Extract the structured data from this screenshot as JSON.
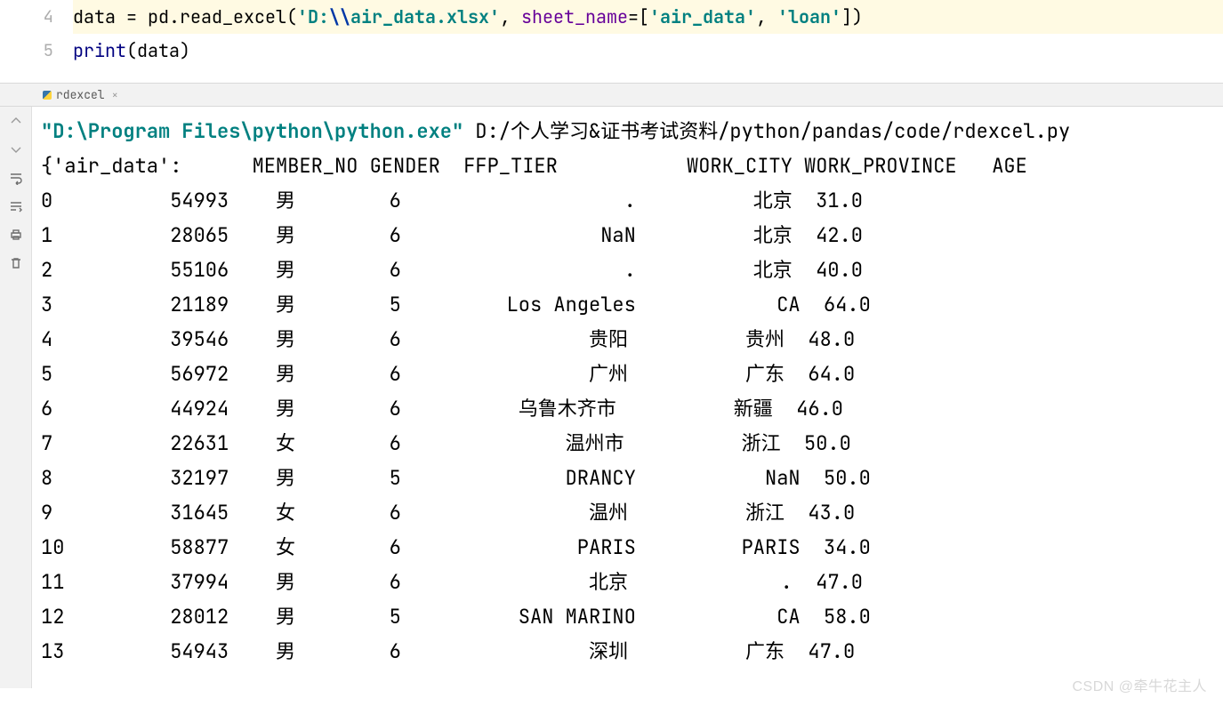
{
  "editor": {
    "lines": [
      {
        "num": "4",
        "tokens": [
          {
            "c": "tk-plain",
            "t": "data "
          },
          {
            "c": "tk-eq",
            "t": "= "
          },
          {
            "c": "tk-call",
            "t": "pd.read_excel("
          },
          {
            "c": "tk-str",
            "t": "'D:"
          },
          {
            "c": "tk-esc",
            "t": "\\\\"
          },
          {
            "c": "tk-str",
            "t": "air_data.xlsx'"
          },
          {
            "c": "tk-plain",
            "t": ", "
          },
          {
            "c": "tk-kw",
            "t": "sheet_name"
          },
          {
            "c": "tk-eq",
            "t": "=["
          },
          {
            "c": "tk-str",
            "t": "'air_data'"
          },
          {
            "c": "tk-plain",
            "t": ", "
          },
          {
            "c": "tk-str",
            "t": "'loan'"
          },
          {
            "c": "tk-plain",
            "t": "])"
          }
        ],
        "current": true
      },
      {
        "num": "5",
        "tokens": [
          {
            "c": "tk-builtin",
            "t": "print"
          },
          {
            "c": "tk-plain",
            "t": "(data)"
          }
        ],
        "current": false
      }
    ]
  },
  "panel": {
    "tab_label": "rdexcel",
    "tab_close": "×"
  },
  "console": {
    "run_line_tokens": [
      {
        "c": "run-str",
        "t": "\"D:\\Program Files\\python\\python.exe\""
      },
      {
        "c": "run-path",
        "t": " D:/个人学习&证书考试资料/python/pandas/code/rdexcel.py"
      }
    ],
    "header": "{'air_data':      MEMBER_NO GENDER  FFP_TIER           WORK_CITY WORK_PROVINCE   AGE",
    "rows": [
      {
        "idx": "0",
        "member": "54993",
        "gender": "男",
        "tier": "6",
        "city": ".",
        "prov": "北京",
        "age": "31.0"
      },
      {
        "idx": "1",
        "member": "28065",
        "gender": "男",
        "tier": "6",
        "city": "NaN",
        "prov": "北京",
        "age": "42.0"
      },
      {
        "idx": "2",
        "member": "55106",
        "gender": "男",
        "tier": "6",
        "city": ".",
        "prov": "北京",
        "age": "40.0"
      },
      {
        "idx": "3",
        "member": "21189",
        "gender": "男",
        "tier": "5",
        "city": "Los Angeles",
        "prov": "CA",
        "age": "64.0"
      },
      {
        "idx": "4",
        "member": "39546",
        "gender": "男",
        "tier": "6",
        "city": "贵阳",
        "prov": "贵州",
        "age": "48.0"
      },
      {
        "idx": "5",
        "member": "56972",
        "gender": "男",
        "tier": "6",
        "city": "广州",
        "prov": "广东",
        "age": "64.0"
      },
      {
        "idx": "6",
        "member": "44924",
        "gender": "男",
        "tier": "6",
        "city": "乌鲁木齐市",
        "prov": "新疆",
        "age": "46.0"
      },
      {
        "idx": "7",
        "member": "22631",
        "gender": "女",
        "tier": "6",
        "city": "温州市",
        "prov": "浙江",
        "age": "50.0"
      },
      {
        "idx": "8",
        "member": "32197",
        "gender": "男",
        "tier": "5",
        "city": "DRANCY",
        "prov": "NaN",
        "age": "50.0"
      },
      {
        "idx": "9",
        "member": "31645",
        "gender": "女",
        "tier": "6",
        "city": "温州",
        "prov": "浙江",
        "age": "43.0"
      },
      {
        "idx": "10",
        "member": "58877",
        "gender": "女",
        "tier": "6",
        "city": "PARIS",
        "prov": "PARIS",
        "age": "34.0"
      },
      {
        "idx": "11",
        "member": "37994",
        "gender": "男",
        "tier": "6",
        "city": "北京",
        "prov": ".",
        "age": "47.0"
      },
      {
        "idx": "12",
        "member": "28012",
        "gender": "男",
        "tier": "5",
        "city": "SAN MARINO",
        "prov": "CA",
        "age": "58.0"
      },
      {
        "idx": "13",
        "member": "54943",
        "gender": "男",
        "tier": "6",
        "city": "深圳",
        "prov": "广东",
        "age": "47.0"
      }
    ]
  },
  "watermark": "CSDN @牵牛花主人"
}
